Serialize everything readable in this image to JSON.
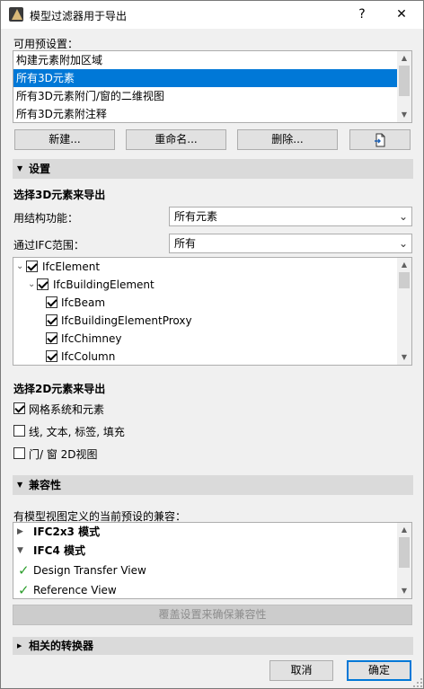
{
  "window": {
    "title": "模型过滤器用于导出",
    "help_label": "?",
    "close_label": "✕"
  },
  "presets": {
    "label": "可用预设置：",
    "items": [
      {
        "label": "构建元素附加区域",
        "selected": false
      },
      {
        "label": "所有3D元素",
        "selected": true
      },
      {
        "label": "所有3D元素附门/窗的二维视图",
        "selected": false
      },
      {
        "label": "所有3D元素附注释",
        "selected": false
      }
    ],
    "buttons": {
      "new": "新建...",
      "rename": "重命名...",
      "delete": "删除..."
    }
  },
  "settings": {
    "header": "设置",
    "select3d_title": "选择3D元素来导出",
    "by_structure_label": "用结构功能：",
    "by_structure_value": "所有元素",
    "by_ifc_label": "通过IFC范围：",
    "by_ifc_value": "所有",
    "tree": [
      {
        "label": "IfcElement",
        "level": 0,
        "expanded": true,
        "checked": true
      },
      {
        "label": "IfcBuildingElement",
        "level": 1,
        "expanded": true,
        "checked": true
      },
      {
        "label": "IfcBeam",
        "level": 2,
        "checked": true
      },
      {
        "label": "IfcBuildingElementProxy",
        "level": 2,
        "checked": true
      },
      {
        "label": "IfcChimney",
        "level": 2,
        "checked": true
      },
      {
        "label": "IfcColumn",
        "level": 2,
        "checked": true
      }
    ],
    "select2d_title": "选择2D元素来导出",
    "options2d": [
      {
        "label": "网格系统和元素",
        "checked": true
      },
      {
        "label": "线, 文本, 标签, 填充",
        "checked": false
      },
      {
        "label": "门/ 窗 2D视图",
        "checked": false
      }
    ]
  },
  "compat": {
    "header": "兼容性",
    "description": "有模型视图定义的当前预设的兼容：",
    "rows": [
      {
        "label": "IFC2x3 模式",
        "kind": "group",
        "expanded": false
      },
      {
        "label": "IFC4 模式",
        "kind": "group",
        "expanded": true
      },
      {
        "label": "Design Transfer View",
        "kind": "item"
      },
      {
        "label": "Reference View",
        "kind": "item"
      }
    ],
    "override_button": "覆盖设置来确保兼容性"
  },
  "converters": {
    "header": "相关的转换器"
  },
  "footer": {
    "cancel": "取消",
    "ok": "确定"
  },
  "colors": {
    "selection": "#0078d7",
    "check_green": "#2e9e2e",
    "section_bg": "#dadada"
  }
}
